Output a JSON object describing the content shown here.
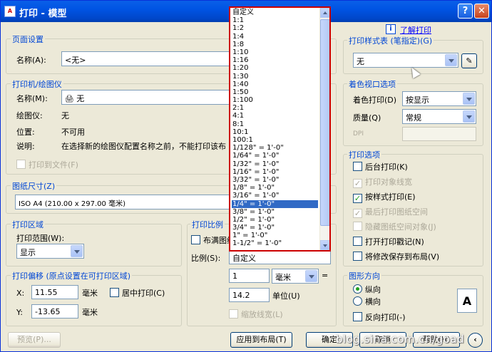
{
  "window": {
    "title": "打印 - 模型",
    "help_glyph": "?",
    "close_glyph": "✕",
    "app_icon": "A"
  },
  "help_link": "了解打印",
  "page_setup": {
    "group": "页面设置",
    "name_label": "名称(A):",
    "name_value": "<无>"
  },
  "printer": {
    "group": "打印机/绘图仪",
    "name_label": "名称(M):",
    "name_value": "无",
    "plotter_label": "绘图仪:",
    "plotter_value": "无",
    "location_label": "位置:",
    "location_value": "不可用",
    "desc_label": "说明:",
    "desc_value": "在选择新的绘图仪配置名称之前，不能打印该布",
    "print_to_file": "打印到文件(F)"
  },
  "paper": {
    "group": "图纸尺寸(Z)",
    "value": "ISO A4 (210.00 x 297.00 毫米)"
  },
  "print_area": {
    "group": "打印区域",
    "range_label": "打印范围(W):",
    "range_value": "显示"
  },
  "print_offset": {
    "group": "打印偏移 (原点设置在可打印区域)",
    "x_label": "X:",
    "x_value": "11.55",
    "x_unit": "毫米",
    "y_label": "Y:",
    "y_value": "-13.65",
    "y_unit": "毫米",
    "center_label": "居中打印(C)"
  },
  "print_scale": {
    "group": "打印比例",
    "fit_label": "布满图纸",
    "scale_label": "比例(S):",
    "scale_value": "自定义",
    "num_value": "1",
    "unit_value": "毫米",
    "eq": "=",
    "den_value": "14.2",
    "den_unit": "单位(U)",
    "lineweights": "缩放线宽(L)"
  },
  "scale_dropdown": {
    "items": [
      "自定义",
      "1:1",
      "1:2",
      "1:4",
      "1:8",
      "1:10",
      "1:16",
      "1:20",
      "1:30",
      "1:40",
      "1:50",
      "1:100",
      "2:1",
      "4:1",
      "8:1",
      "10:1",
      "100:1",
      "1/128\" = 1'-0\"",
      "1/64\" = 1'-0\"",
      "1/32\" = 1'-0\"",
      "1/16\" = 1'-0\"",
      "3/32\" = 1'-0\"",
      "1/8\" = 1'-0\"",
      "3/16\" = 1'-0\"",
      "1/4\" = 1'-0\"",
      "3/8\" = 1'-0\"",
      "1/2\" = 1'-0\"",
      "3/4\" = 1'-0\"",
      "1\" = 1'-0\"",
      "1-1/2\" = 1'-0\""
    ],
    "selected_index": 24
  },
  "plot_style": {
    "group": "打印样式表 (笔指定)(G)",
    "value": "无"
  },
  "shaded_viewport": {
    "group": "着色视口选项",
    "shade_label": "着色打印(D)",
    "shade_value": "按显示",
    "quality_label": "质量(Q)",
    "quality_value": "常规",
    "dpi_label": "DPI"
  },
  "plot_options": {
    "group": "打印选项",
    "items": [
      {
        "label": "后台打印(K)",
        "checked": false,
        "disabled": false
      },
      {
        "label": "打印对象线宽",
        "checked": true,
        "disabled": true
      },
      {
        "label": "按样式打印(E)",
        "checked": true,
        "disabled": false
      },
      {
        "label": "最后打印图纸空间",
        "checked": true,
        "disabled": true
      },
      {
        "label": "隐藏图纸空间对象(J)",
        "checked": false,
        "disabled": true
      },
      {
        "label": "打开打印戳记(N)",
        "checked": false,
        "disabled": false
      },
      {
        "label": "将修改保存到布局(V)",
        "checked": false,
        "disabled": false
      }
    ]
  },
  "orientation": {
    "group": "图形方向",
    "portrait": "纵向",
    "landscape": "横向",
    "upside_down": "反向打印(-)",
    "paper_glyph": "A"
  },
  "buttons": {
    "preview": "预览(P)...",
    "apply": "应用到布局(T)",
    "ok": "确定",
    "cancel": "取消",
    "help": "帮助(H)"
  },
  "watermark": "blog.sina.com.cn/goad"
}
